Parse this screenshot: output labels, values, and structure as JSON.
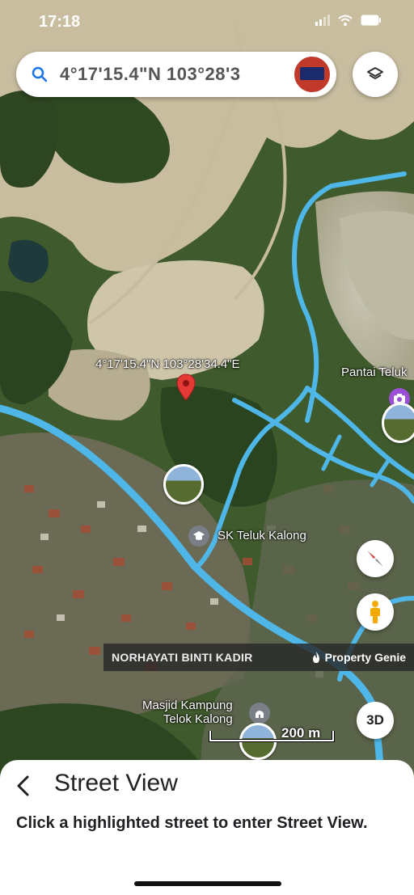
{
  "status_bar": {
    "time": "17:18"
  },
  "search": {
    "query": "4°17'15.4\"N 103°28'3"
  },
  "map": {
    "coordinate_label": "4°17'15.4\"N 103°28'34.4\"E",
    "poi_pantai": "Pantai Teluk",
    "poi_school": "SK Teluk Kalong",
    "poi_masjid_line1": "Masjid Kampung",
    "poi_masjid_line2": "Telok Kalong",
    "scale_label": "200 m"
  },
  "banner": {
    "left_text": "NORHAYATI BINTI KADIR",
    "right_text": "Property Genie"
  },
  "buttons": {
    "three_d": "3D"
  },
  "sheet": {
    "title": "Street View",
    "instruction": "Click a highlighted street to enter Street View."
  },
  "colors": {
    "street_view_blue": "#4fb6e8",
    "pin_red": "#e53935",
    "poi_purple": "#9c4fd6"
  }
}
